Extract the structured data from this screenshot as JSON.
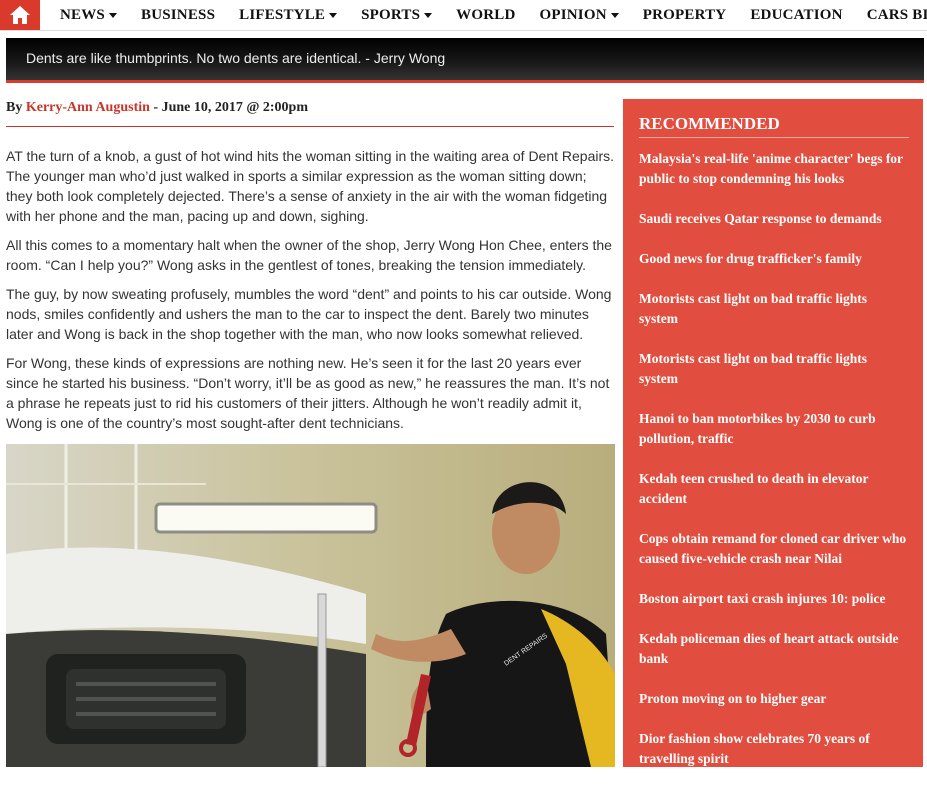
{
  "nav": {
    "home_icon": "home-icon",
    "items": [
      {
        "label": "NEWS",
        "dropdown": true
      },
      {
        "label": "BUSINESS",
        "dropdown": false
      },
      {
        "label": "LIFESTYLE",
        "dropdown": true
      },
      {
        "label": "SPORTS",
        "dropdown": true
      },
      {
        "label": "WORLD",
        "dropdown": false
      },
      {
        "label": "OPINION",
        "dropdown": true
      },
      {
        "label": "PROPERTY",
        "dropdown": false
      },
      {
        "label": "EDUCATION",
        "dropdown": false
      },
      {
        "label": "CARS BIKES TR",
        "dropdown": false
      }
    ]
  },
  "banner": {
    "quote": "Dents are like thumbprints. No two dents are identical. - Jerry Wong"
  },
  "article": {
    "by": "By",
    "author": "Kerry-Ann Augustin",
    "date": "- June 10, 2017 @ 2:00pm",
    "paragraphs": [
      "AT the turn of a knob, a gust of hot wind hits the woman sitting in the waiting area of Dent Repairs. The younger man who’d just walked in sports a similar expression as the woman sitting down; they both look completely dejected. There’s a sense of anxiety in the air with the woman fidgeting with her phone and the man, pacing up and down, sighing.",
      "All this comes to a momentary halt when the owner of the shop, Jerry Wong Hon Chee, enters the room. “Can I help you?” Wong asks in the gentlest of tones, breaking the tension immediately.",
      "The guy, by now sweating profusely, mumbles the word “dent” and points to his car outside. Wong nods, smiles confidently and ushers the man to the car to inspect the dent. Barely two minutes later and Wong is back in the shop together with the man, who now looks somewhat relieved.",
      "For Wong, these kinds of expressions are nothing new. He’s seen it for the last 20 years ever since he started his business. “Don’t worry, it’ll be as good as new,” he reassures the man. It’s not a phrase he repeats just to rid his customers of their jitters. Although he won’t readily admit it, Wong is one of the country’s most sought-after dent technicians."
    ],
    "photo_shirt_text": "DENT REPAIRS"
  },
  "sidebar": {
    "title": "RECOMMENDED",
    "items": [
      "Malaysia's real-life 'anime character' begs for public to stop condemning his looks",
      "Saudi receives Qatar response to demands",
      "Good news for drug trafficker's family",
      "Motorists cast light on bad traffic lights system",
      "Motorists cast light on bad traffic lights system",
      "Hanoi to ban motorbikes by 2030 to curb pollution, traffic",
      "Kedah teen crushed to death in elevator accident",
      "Cops obtain remand for cloned car driver who caused five-vehicle crash near Nilai",
      "Boston airport taxi crash injures 10: police",
      "Kedah policeman dies of heart attack outside bank",
      "Proton moving on to higher gear",
      "Dior fashion show celebrates 70 years of travelling spirit"
    ]
  },
  "colors": {
    "accent": "#d93a2b",
    "sidebar_bg": "#e14d3e",
    "author": "#c8352a"
  }
}
